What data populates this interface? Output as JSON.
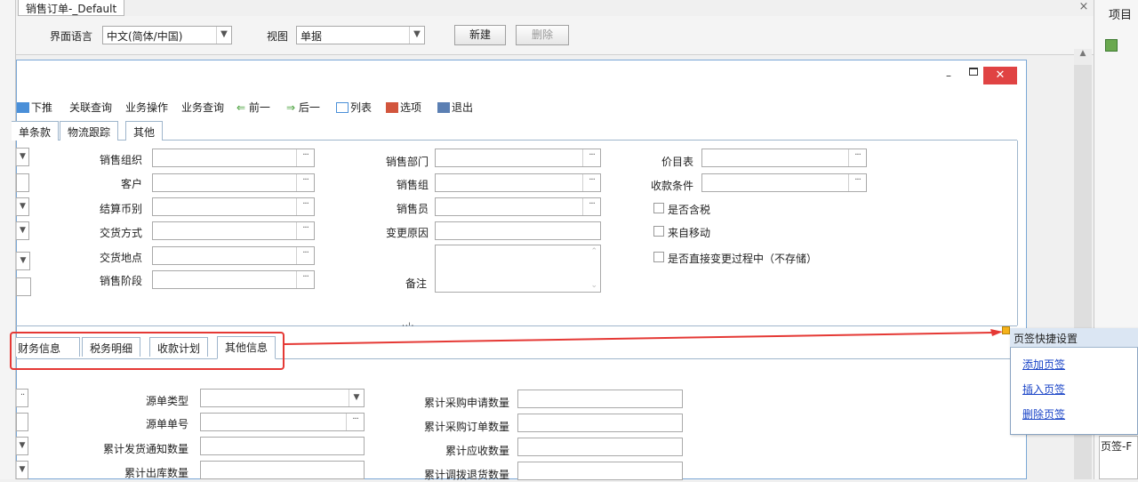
{
  "document_tab": {
    "title": "销售订单-_Default",
    "close": "×"
  },
  "top_bar": {
    "language_label": "界面语言",
    "language_value": "中文(简体/中国)",
    "view_label": "视图",
    "view_value": "单据",
    "new_button": "新建",
    "delete_button": "删除"
  },
  "right_panel": {
    "title": "项目",
    "tab_label": "页签-F"
  },
  "inner_window": {
    "minimize": "–",
    "close": "✕"
  },
  "toolbar": [
    {
      "label": "下推",
      "icon": "push-down-icon"
    },
    {
      "label": "关联查询"
    },
    {
      "label": "业务操作"
    },
    {
      "label": "业务查询"
    },
    {
      "label": "前一",
      "icon": "arrow-left-icon"
    },
    {
      "label": "后一",
      "icon": "arrow-right-icon"
    },
    {
      "label": "列表",
      "icon": "list-icon"
    },
    {
      "label": "选项",
      "icon": "options-icon"
    },
    {
      "label": "退出",
      "icon": "exit-icon"
    }
  ],
  "upper_tabs": [
    "单条款",
    "物流跟踪",
    "其他"
  ],
  "form_upper": {
    "col1": [
      "销售组织",
      "客户",
      "结算币别",
      "交货方式",
      "交货地点",
      "销售阶段"
    ],
    "col2": [
      "销售部门",
      "销售组",
      "销售员",
      "变更原因",
      "备注"
    ],
    "col3_fields": [
      "价目表",
      "收款条件"
    ],
    "col3_checks": [
      "是否含税",
      "来自移动",
      "是否直接变更过程中（不存储）"
    ]
  },
  "lower_tabs": [
    "财务信息",
    "税务明细",
    "收款计划",
    "其他信息"
  ],
  "form_lower": {
    "col1": [
      "源单类型",
      "源单单号",
      "累计发货通知数量",
      "累计出库数量"
    ],
    "col2": [
      "累计采购申请数量",
      "累计采购订单数量",
      "累计应收数量",
      "累计调拨退货数量"
    ]
  },
  "popup": {
    "title": "页签快捷设置",
    "items": [
      "添加页签",
      "插入页签",
      "删除页签"
    ]
  },
  "colors": {
    "accent": "#1a44c7",
    "highlight": "#e53935",
    "window_border": "#7aa7d6"
  }
}
